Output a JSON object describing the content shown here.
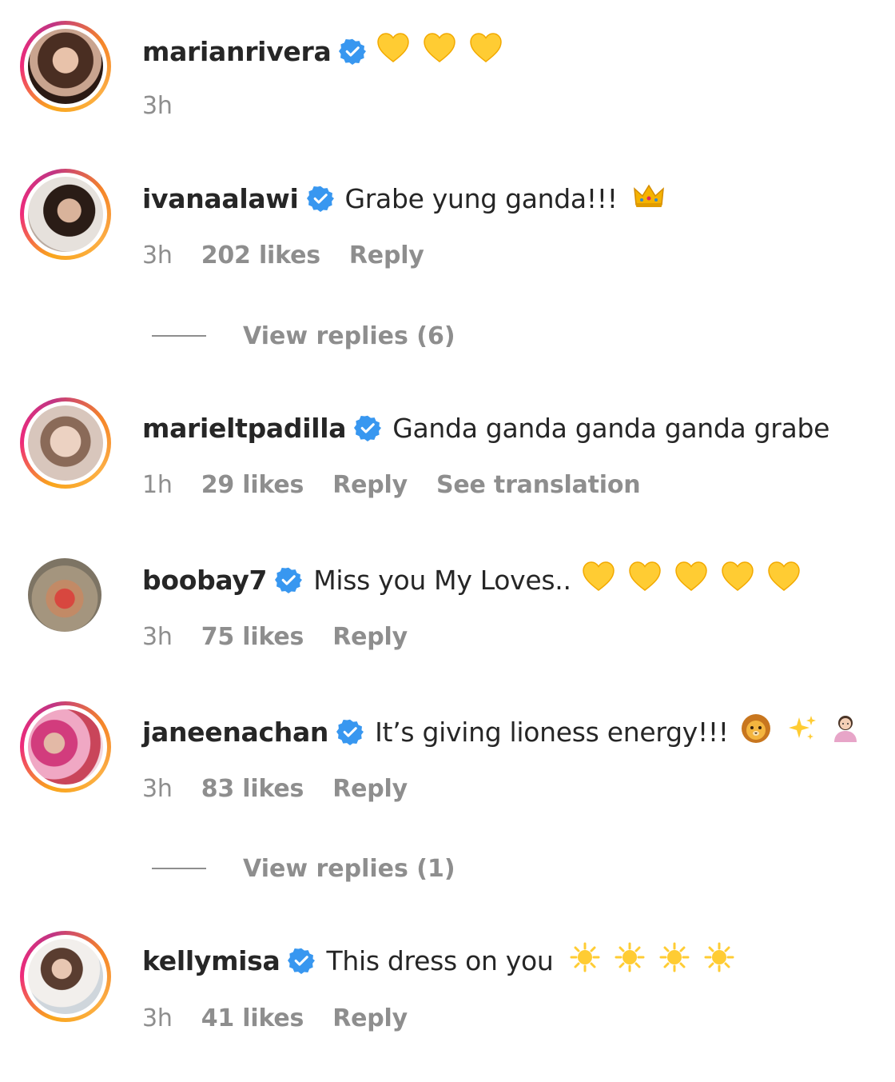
{
  "colors": {
    "verified": "#3897f0",
    "muted": "#8e8e8e",
    "text": "#262626",
    "heart": "#ffcc33"
  },
  "comments": [
    {
      "username": "marianrivera",
      "verified": true,
      "text": "",
      "emojis": [
        "yellow-heart",
        "yellow-heart",
        "yellow-heart"
      ],
      "time": "3h",
      "likes": "",
      "reply": "",
      "translation": ""
    },
    {
      "username": "ivanaalawi",
      "verified": true,
      "text": "Grabe yung ganda!!!",
      "emojis": [
        "crown"
      ],
      "time": "3h",
      "likes": "202 likes",
      "reply": "Reply",
      "translation": ""
    },
    {
      "username": "marieltpadilla",
      "verified": true,
      "text": "Ganda ganda ganda ganda grabe",
      "emojis": [],
      "time": "1h",
      "likes": "29 likes",
      "reply": "Reply",
      "translation": "See translation"
    },
    {
      "username": "boobay7",
      "verified": true,
      "text": "Miss you My Loves..",
      "emojis": [
        "yellow-heart",
        "yellow-heart",
        "yellow-heart",
        "yellow-heart",
        "yellow-heart"
      ],
      "time": "3h",
      "likes": "75 likes",
      "reply": "Reply",
      "translation": ""
    },
    {
      "username": "janeenachan",
      "verified": true,
      "text": "It’s giving lioness energy!!!",
      "emojis": [
        "lion-face",
        "sparkles",
        "woman-gesturing"
      ],
      "time": "3h",
      "likes": "83 likes",
      "reply": "Reply",
      "translation": ""
    },
    {
      "username": "kellymisa",
      "verified": true,
      "text": "This dress on you",
      "emojis": [
        "sun",
        "sun",
        "sun",
        "sun"
      ],
      "time": "3h",
      "likes": "41 likes",
      "reply": "Reply",
      "translation": ""
    }
  ],
  "view_replies": [
    {
      "label": "View replies (6)"
    },
    {
      "label": "View replies (1)"
    }
  ]
}
